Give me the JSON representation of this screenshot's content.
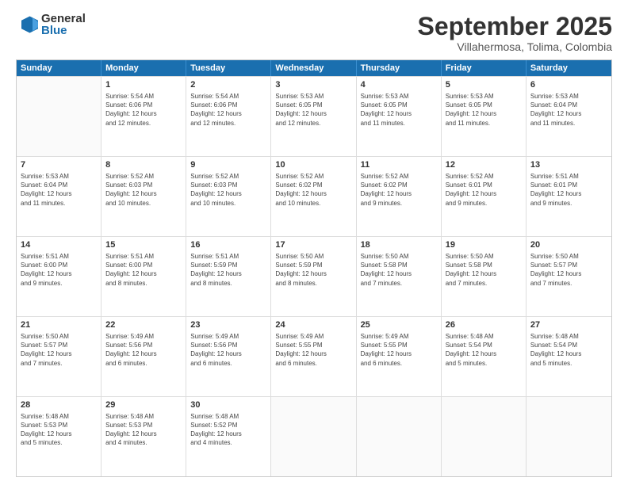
{
  "logo": {
    "general": "General",
    "blue": "Blue"
  },
  "header": {
    "month": "September 2025",
    "location": "Villahermosa, Tolima, Colombia"
  },
  "days": [
    "Sunday",
    "Monday",
    "Tuesday",
    "Wednesday",
    "Thursday",
    "Friday",
    "Saturday"
  ],
  "weeks": [
    [
      {
        "day": "",
        "info": ""
      },
      {
        "day": "1",
        "info": "Sunrise: 5:54 AM\nSunset: 6:06 PM\nDaylight: 12 hours\nand 12 minutes."
      },
      {
        "day": "2",
        "info": "Sunrise: 5:54 AM\nSunset: 6:06 PM\nDaylight: 12 hours\nand 12 minutes."
      },
      {
        "day": "3",
        "info": "Sunrise: 5:53 AM\nSunset: 6:05 PM\nDaylight: 12 hours\nand 12 minutes."
      },
      {
        "day": "4",
        "info": "Sunrise: 5:53 AM\nSunset: 6:05 PM\nDaylight: 12 hours\nand 11 minutes."
      },
      {
        "day": "5",
        "info": "Sunrise: 5:53 AM\nSunset: 6:05 PM\nDaylight: 12 hours\nand 11 minutes."
      },
      {
        "day": "6",
        "info": "Sunrise: 5:53 AM\nSunset: 6:04 PM\nDaylight: 12 hours\nand 11 minutes."
      }
    ],
    [
      {
        "day": "7",
        "info": "Sunrise: 5:53 AM\nSunset: 6:04 PM\nDaylight: 12 hours\nand 11 minutes."
      },
      {
        "day": "8",
        "info": "Sunrise: 5:52 AM\nSunset: 6:03 PM\nDaylight: 12 hours\nand 10 minutes."
      },
      {
        "day": "9",
        "info": "Sunrise: 5:52 AM\nSunset: 6:03 PM\nDaylight: 12 hours\nand 10 minutes."
      },
      {
        "day": "10",
        "info": "Sunrise: 5:52 AM\nSunset: 6:02 PM\nDaylight: 12 hours\nand 10 minutes."
      },
      {
        "day": "11",
        "info": "Sunrise: 5:52 AM\nSunset: 6:02 PM\nDaylight: 12 hours\nand 9 minutes."
      },
      {
        "day": "12",
        "info": "Sunrise: 5:52 AM\nSunset: 6:01 PM\nDaylight: 12 hours\nand 9 minutes."
      },
      {
        "day": "13",
        "info": "Sunrise: 5:51 AM\nSunset: 6:01 PM\nDaylight: 12 hours\nand 9 minutes."
      }
    ],
    [
      {
        "day": "14",
        "info": "Sunrise: 5:51 AM\nSunset: 6:00 PM\nDaylight: 12 hours\nand 9 minutes."
      },
      {
        "day": "15",
        "info": "Sunrise: 5:51 AM\nSunset: 6:00 PM\nDaylight: 12 hours\nand 8 minutes."
      },
      {
        "day": "16",
        "info": "Sunrise: 5:51 AM\nSunset: 5:59 PM\nDaylight: 12 hours\nand 8 minutes."
      },
      {
        "day": "17",
        "info": "Sunrise: 5:50 AM\nSunset: 5:59 PM\nDaylight: 12 hours\nand 8 minutes."
      },
      {
        "day": "18",
        "info": "Sunrise: 5:50 AM\nSunset: 5:58 PM\nDaylight: 12 hours\nand 7 minutes."
      },
      {
        "day": "19",
        "info": "Sunrise: 5:50 AM\nSunset: 5:58 PM\nDaylight: 12 hours\nand 7 minutes."
      },
      {
        "day": "20",
        "info": "Sunrise: 5:50 AM\nSunset: 5:57 PM\nDaylight: 12 hours\nand 7 minutes."
      }
    ],
    [
      {
        "day": "21",
        "info": "Sunrise: 5:50 AM\nSunset: 5:57 PM\nDaylight: 12 hours\nand 7 minutes."
      },
      {
        "day": "22",
        "info": "Sunrise: 5:49 AM\nSunset: 5:56 PM\nDaylight: 12 hours\nand 6 minutes."
      },
      {
        "day": "23",
        "info": "Sunrise: 5:49 AM\nSunset: 5:56 PM\nDaylight: 12 hours\nand 6 minutes."
      },
      {
        "day": "24",
        "info": "Sunrise: 5:49 AM\nSunset: 5:55 PM\nDaylight: 12 hours\nand 6 minutes."
      },
      {
        "day": "25",
        "info": "Sunrise: 5:49 AM\nSunset: 5:55 PM\nDaylight: 12 hours\nand 6 minutes."
      },
      {
        "day": "26",
        "info": "Sunrise: 5:48 AM\nSunset: 5:54 PM\nDaylight: 12 hours\nand 5 minutes."
      },
      {
        "day": "27",
        "info": "Sunrise: 5:48 AM\nSunset: 5:54 PM\nDaylight: 12 hours\nand 5 minutes."
      }
    ],
    [
      {
        "day": "28",
        "info": "Sunrise: 5:48 AM\nSunset: 5:53 PM\nDaylight: 12 hours\nand 5 minutes."
      },
      {
        "day": "29",
        "info": "Sunrise: 5:48 AM\nSunset: 5:53 PM\nDaylight: 12 hours\nand 4 minutes."
      },
      {
        "day": "30",
        "info": "Sunrise: 5:48 AM\nSunset: 5:52 PM\nDaylight: 12 hours\nand 4 minutes."
      },
      {
        "day": "",
        "info": ""
      },
      {
        "day": "",
        "info": ""
      },
      {
        "day": "",
        "info": ""
      },
      {
        "day": "",
        "info": ""
      }
    ]
  ]
}
